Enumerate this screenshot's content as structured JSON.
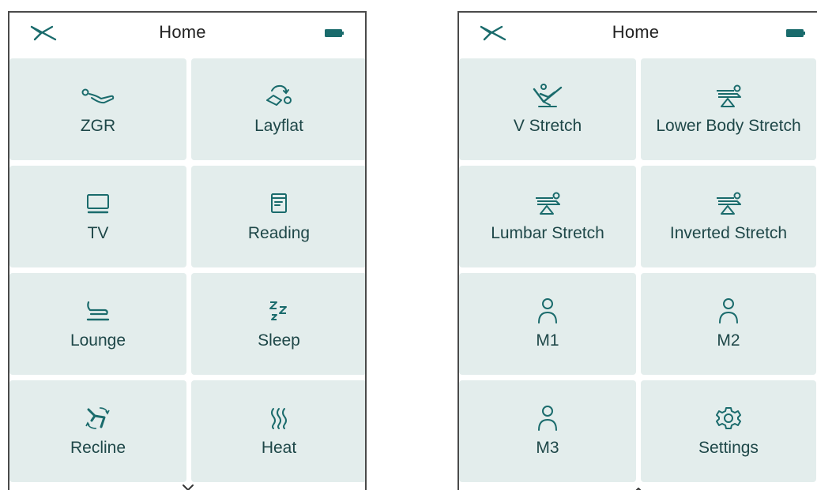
{
  "colors": {
    "accent": "#1a6b6c",
    "tile_bg": "#e3edec",
    "label": "#1e4748"
  },
  "screens": [
    {
      "title": "Home",
      "tiles": [
        {
          "label": "ZGR",
          "icon": "zero-gravity-icon"
        },
        {
          "label": "Layflat",
          "icon": "layflat-icon"
        },
        {
          "label": "TV",
          "icon": "tv-icon"
        },
        {
          "label": "Reading",
          "icon": "book-icon"
        },
        {
          "label": "Lounge",
          "icon": "lounge-chair-icon"
        },
        {
          "label": "Sleep",
          "icon": "zzz-icon"
        },
        {
          "label": "Recline",
          "icon": "recline-icon"
        },
        {
          "label": "Heat",
          "icon": "heat-icon"
        }
      ],
      "scroll_indicator": "chevron-down-icon"
    },
    {
      "title": "Home",
      "tiles": [
        {
          "label": "V Stretch",
          "icon": "v-stretch-icon"
        },
        {
          "label": "Lower Body Stretch",
          "icon": "lower-body-stretch-icon"
        },
        {
          "label": "Lumbar Stretch",
          "icon": "lumbar-stretch-icon"
        },
        {
          "label": "Inverted Stretch",
          "icon": "inverted-stretch-icon"
        },
        {
          "label": "M1",
          "icon": "user-icon"
        },
        {
          "label": "M2",
          "icon": "user-icon"
        },
        {
          "label": "M3",
          "icon": "user-icon"
        },
        {
          "label": "Settings",
          "icon": "gear-icon"
        }
      ],
      "scroll_indicator": "chevron-up-icon"
    }
  ]
}
